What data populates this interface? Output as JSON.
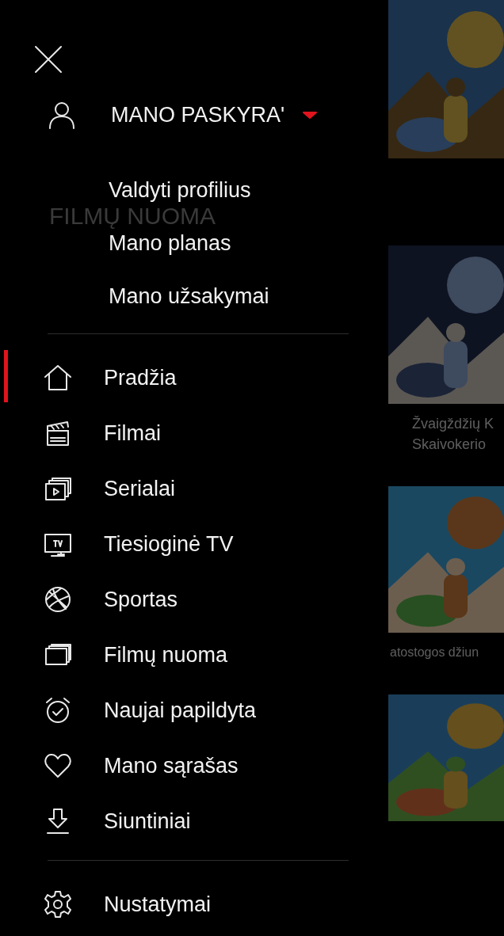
{
  "account": {
    "label": "MANO PASKYRA'",
    "expanded": true,
    "items": [
      {
        "label": "Valdyti profilius"
      },
      {
        "label": "Mano planas"
      },
      {
        "label": "Mano užsakymai"
      }
    ]
  },
  "menu": [
    {
      "label": "Pradžia",
      "kind": "home",
      "selected": true
    },
    {
      "label": "Filmai",
      "kind": "clapper",
      "selected": false
    },
    {
      "label": "Serialai",
      "kind": "series",
      "selected": false
    },
    {
      "label": "Tiesioginė TV",
      "kind": "tv",
      "selected": false
    },
    {
      "label": "Sportas",
      "kind": "ball",
      "selected": false
    },
    {
      "label": "Filmų nuoma",
      "kind": "cards",
      "selected": false
    },
    {
      "label": "Naujai papildyta",
      "kind": "clock",
      "selected": false
    },
    {
      "label": "Mano sąrašas",
      "kind": "heart",
      "selected": false
    },
    {
      "label": "Siuntiniai",
      "kind": "download",
      "selected": false
    }
  ],
  "settings": {
    "label": "Nustatymai"
  },
  "background": {
    "heading": "FILMŲ NUOMA",
    "captions": [
      {
        "lines": [
          "Žvaigždžių K",
          "Skaivokerio"
        ]
      },
      {
        "lines": [
          "atostogos džiun"
        ]
      }
    ]
  }
}
